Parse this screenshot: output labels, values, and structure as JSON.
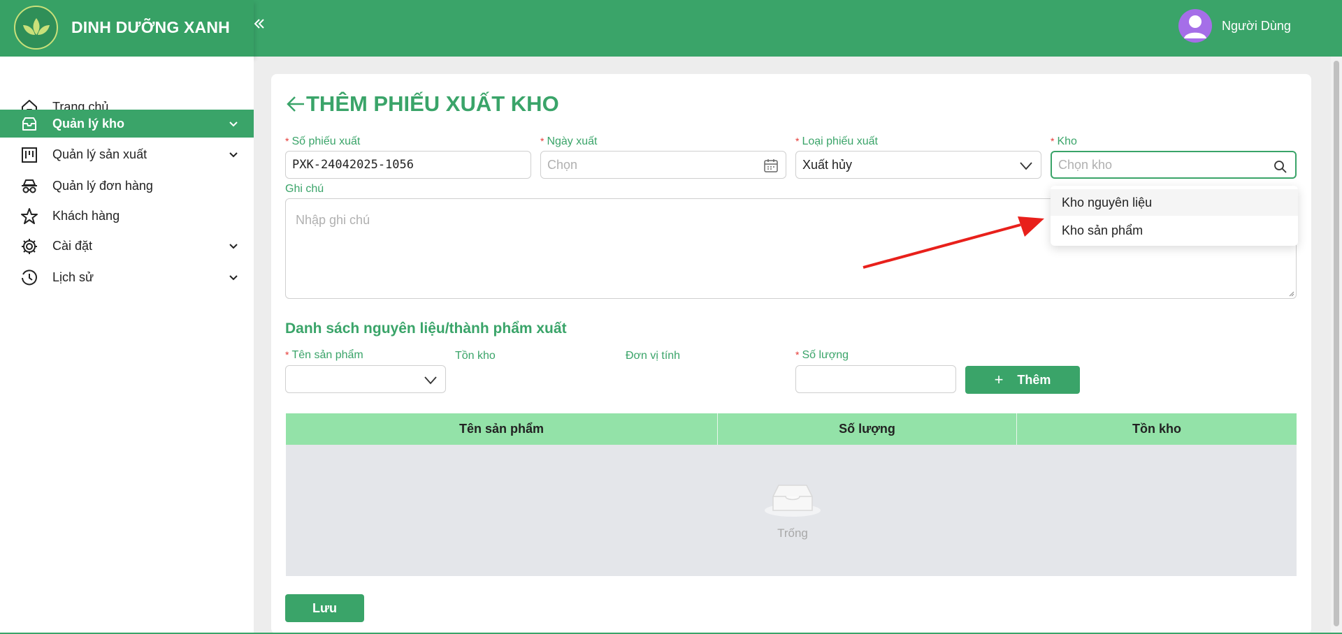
{
  "app": {
    "brand": "DINH DƯỠNG XANH",
    "user_name": "Người Dùng"
  },
  "colors": {
    "primary": "#3aa469",
    "table_header": "#93e2a8",
    "required": "#e53935",
    "empty_body": "#e4e6ea"
  },
  "sidebar": {
    "items": [
      {
        "label": "Trang chủ",
        "icon": "home-icon",
        "active": false,
        "has_children": false
      },
      {
        "label": "Quản lý kho",
        "icon": "inbox-icon",
        "active": true,
        "has_children": true
      },
      {
        "label": "Quản lý sản xuất",
        "icon": "kanban-icon",
        "active": false,
        "has_children": true
      },
      {
        "label": "Quản lý đơn hàng",
        "icon": "incognito-icon",
        "active": false,
        "has_children": false
      },
      {
        "label": "Khách hàng",
        "icon": "star-icon",
        "active": false,
        "has_children": false
      },
      {
        "label": "Cài đặt",
        "icon": "gear-icon",
        "active": false,
        "has_children": true
      },
      {
        "label": "Lịch sử",
        "icon": "clock-icon",
        "active": false,
        "has_children": true
      }
    ]
  },
  "page": {
    "title": "THÊM PHIẾU XUẤT KHO"
  },
  "form": {
    "so_phieu": {
      "label": "Số phiếu xuất",
      "value": "PXK-24042025-1056"
    },
    "ngay_xuat": {
      "label": "Ngày xuất",
      "placeholder": "Chọn"
    },
    "loai_phieu": {
      "label": "Loại phiếu xuất",
      "value": "Xuất hủy"
    },
    "kho": {
      "label": "Kho",
      "placeholder": "Chọn kho",
      "options": [
        "Kho nguyên liệu",
        "Kho sản phẩm"
      ]
    },
    "ghi_chu": {
      "label": "Ghi chú",
      "placeholder": "Nhập ghi chú"
    }
  },
  "items_section": {
    "title": "Danh sách nguyên liệu/thành phẩm xuất",
    "ten_sp_label": "Tên sản phẩm",
    "ton_kho_label": "Tồn kho",
    "don_vi_label": "Đơn vị tính",
    "so_luong_label": "Số lượng",
    "add_button": "Thêm"
  },
  "table": {
    "columns": [
      "Tên sản phẩm",
      "Số lượng",
      "Tồn kho"
    ],
    "rows": [],
    "empty_text": "Trống"
  },
  "save_button": "Lưu"
}
